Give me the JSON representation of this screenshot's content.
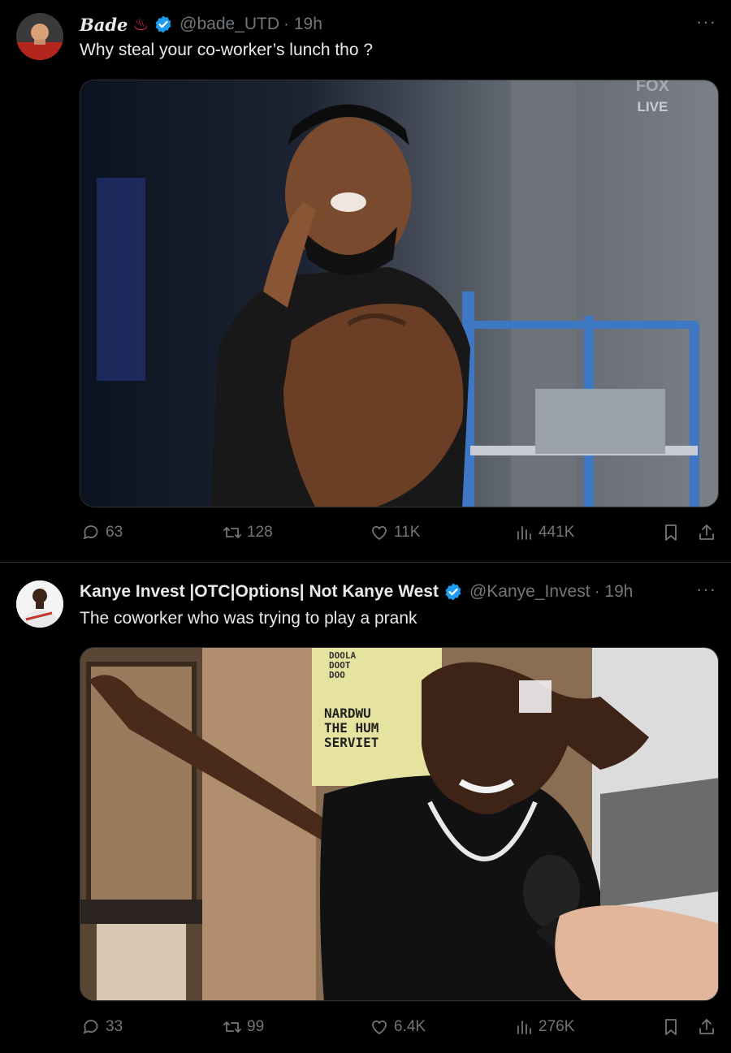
{
  "tweets": [
    {
      "name": "Bade",
      "name_emoji": "♨",
      "handle": "@bade_UTD",
      "time": "· 19h",
      "text": "Why steal your co-worker’s lunch tho ?",
      "media_overlay": {
        "line1": "FOX",
        "line2": "LIVE"
      },
      "replies": "63",
      "reposts": "128",
      "likes": "11K",
      "views": "441K"
    },
    {
      "name": "Kanye Invest |OTC|Options| Not Kanye West",
      "handle": "@Kanye_Invest",
      "time": "· 19h",
      "text": "The coworker who was trying to play a prank",
      "media_signs": {
        "sign1": "NARDWU\nTHE HUM\nSERVIET",
        "sign2": "DOOLA\nDOOT\nDOO"
      },
      "replies": "33",
      "reposts": "99",
      "likes": "6.4K",
      "views": "276K"
    }
  ],
  "icons": {
    "more": "more-icon",
    "reply": "reply-icon",
    "repost": "repost-icon",
    "like": "heart-icon",
    "views": "views-icon",
    "bookmark": "bookmark-icon",
    "share": "share-icon",
    "verified": "verified-badge-icon"
  },
  "colors": {
    "background": "#000000",
    "text": "#e7e9ea",
    "muted": "#71767b",
    "verified": "#1d9bf0",
    "emoji_red": "#e0245e"
  }
}
